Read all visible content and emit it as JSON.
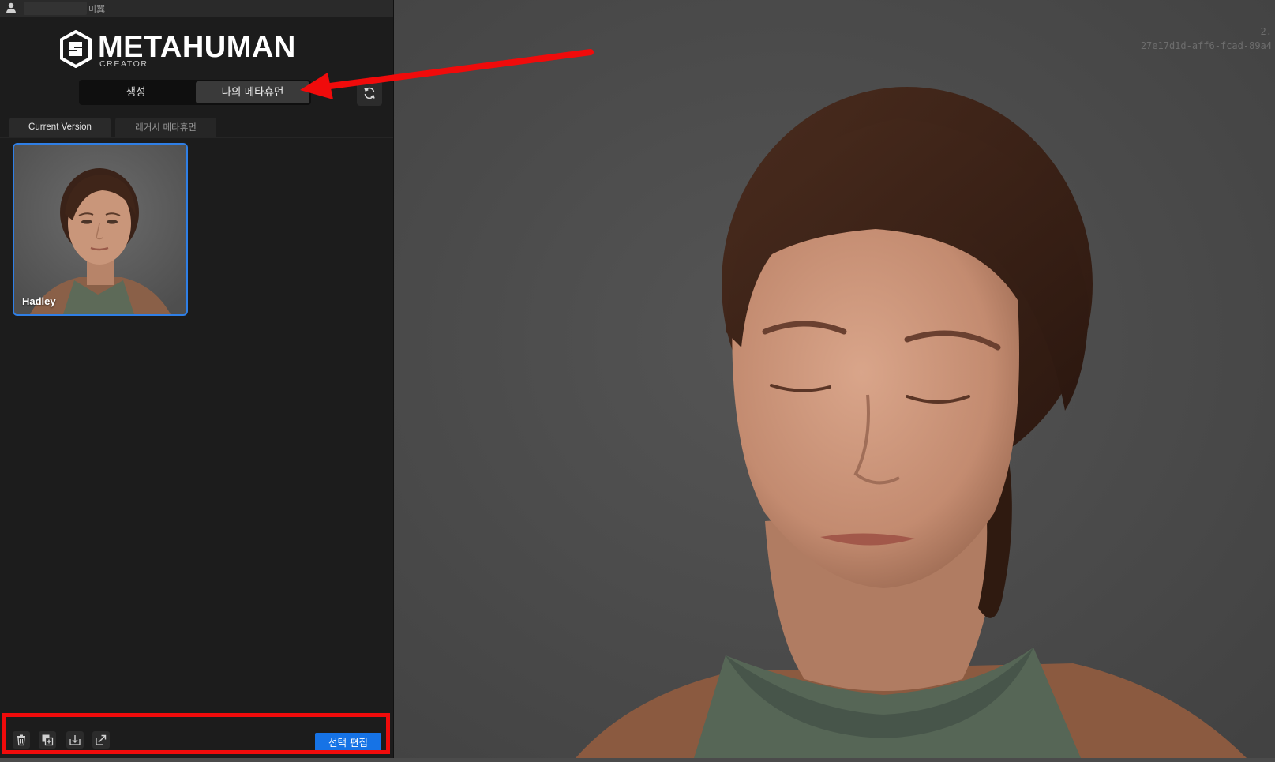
{
  "topbar": {
    "title": "미翼"
  },
  "logo": {
    "name": "METAHUMAN",
    "subtitle": "CREATOR"
  },
  "main_tabs": [
    {
      "label": "생성",
      "active": false
    },
    {
      "label": "나의 메타휴먼",
      "active": true
    }
  ],
  "sub_tabs": [
    {
      "label": "Current Version",
      "active": true
    },
    {
      "label": "레거시 메타휴먼",
      "active": false
    }
  ],
  "cards": [
    {
      "name": "Hadley",
      "selected": true
    }
  ],
  "toolbar": {
    "icons": [
      "trash-icon",
      "duplicate-icon",
      "download-icon",
      "export-icon"
    ],
    "edit_label": "선택 편집"
  },
  "viewport": {
    "version_line1": "2.",
    "version_line2": "27e17d1d-aff6-fcad-89a4"
  },
  "colors": {
    "accent": "#1673e6",
    "selection": "#2f7fe6",
    "annotation": "#f00b0b",
    "panel_bg": "#1c1c1c",
    "viewport_bg": "#4b4b4b"
  }
}
